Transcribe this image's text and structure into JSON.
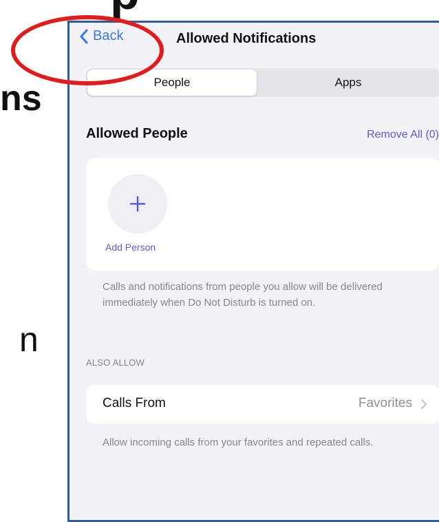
{
  "background": {
    "top_fragment": "p",
    "left_fragment_1": "ns",
    "left_fragment_2": "n"
  },
  "navbar": {
    "back_label": "Back",
    "title": "Allowed Notifications"
  },
  "segments": {
    "people": "People",
    "apps": "Apps",
    "selected": "People"
  },
  "allowed_people": {
    "title": "Allowed People",
    "remove_all": "Remove All (0)",
    "add_person": "Add Person",
    "footnote": "Calls and notifications from people you allow will be delivered immediately when Do Not Disturb is turned on."
  },
  "also_allow": {
    "header": "ALSO ALLOW",
    "calls_from_label": "Calls From",
    "calls_from_value": "Favorites",
    "footnote": "Allow incoming calls from your favorites and repeated calls."
  },
  "colors": {
    "accent_blue": "#3478f6",
    "accent_purple": "#5b5bd6",
    "annotation_red": "#e21b1b",
    "screen_border": "#2e5b9a"
  },
  "icons": [
    "chevron-left-icon",
    "plus-icon",
    "chevron-right-icon"
  ]
}
